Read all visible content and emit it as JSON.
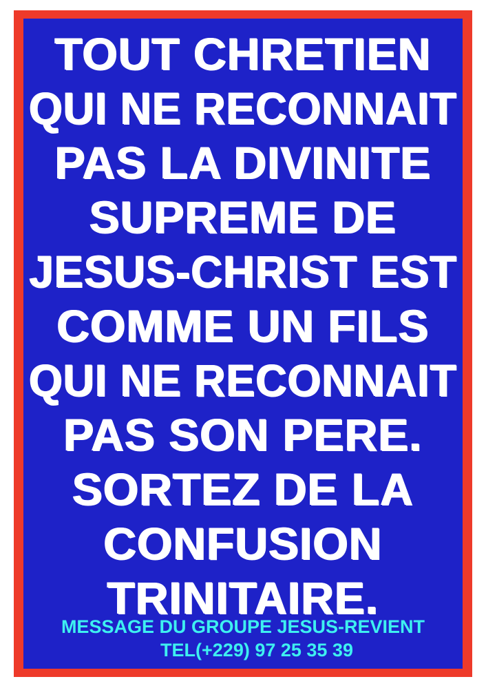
{
  "colors": {
    "border": "#ee3a2a",
    "background": "#1e22c8",
    "headline_text": "#ffffff",
    "footer_text": "#3ef0f0"
  },
  "headline": {
    "lines": [
      "TOUT CHRETIEN",
      "QUI NE RECONNAIT",
      "PAS LA DIVINITE",
      "SUPREME DE",
      "JESUS-CHRIST EST",
      "COMME UN FILS",
      "QUI NE RECONNAIT",
      "PAS SON PERE.",
      "SORTEZ DE LA",
      "CONFUSION",
      "TRINITAIRE."
    ]
  },
  "footer": {
    "message": "MESSAGE DU GROUPE JESUS-REVIENT",
    "phone": "TEL(+229) 97 25 35 39"
  }
}
